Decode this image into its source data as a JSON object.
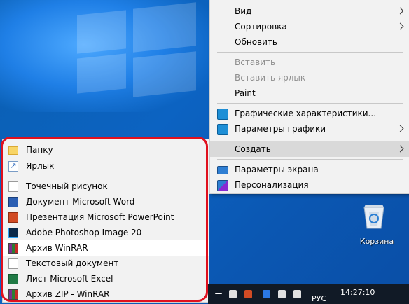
{
  "context_menu": {
    "items": [
      {
        "label": "Вид"
      },
      {
        "label": "Сортировка"
      },
      {
        "label": "Обновить"
      },
      {
        "label": "Вставить"
      },
      {
        "label": "Вставить ярлык"
      },
      {
        "label": "Paint"
      },
      {
        "label": "Графические характеристики..."
      },
      {
        "label": "Параметры графики"
      },
      {
        "label": "Создать"
      },
      {
        "label": "Параметры экрана"
      },
      {
        "label": "Персонализация"
      }
    ]
  },
  "submenu": {
    "items": [
      {
        "label": "Папку"
      },
      {
        "label": "Ярлык"
      },
      {
        "label": "Точечный рисунок"
      },
      {
        "label": "Документ Microsoft Word"
      },
      {
        "label": "Презентация Microsoft PowerPoint"
      },
      {
        "label": "Adobe Photoshop Image 20"
      },
      {
        "label": "Архив WinRAR"
      },
      {
        "label": "Текстовый документ"
      },
      {
        "label": "Лист Microsoft Excel"
      },
      {
        "label": "Архив ZIP - WinRAR"
      }
    ]
  },
  "desktop": {
    "recycle_bin_label": "Корзина"
  },
  "taskbar": {
    "language": "РУС",
    "time": "14:27:10"
  },
  "colors": {
    "highlight_ring": "#e0101e",
    "menu_bg": "#f2f2f2",
    "desktop_blue": "#0b5fc0"
  }
}
